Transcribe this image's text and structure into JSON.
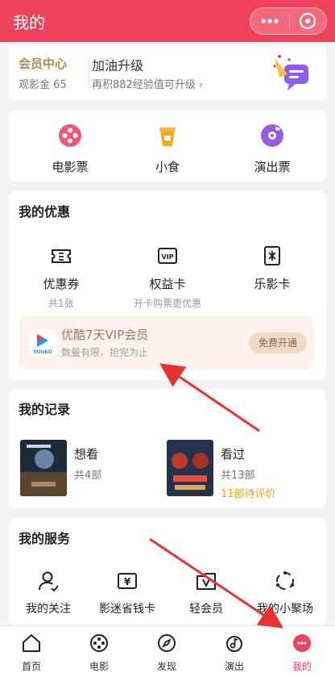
{
  "header": {
    "title": "我的"
  },
  "member": {
    "title": "会员中心",
    "balance": "观影金 65",
    "upgrade_title": "加油升级",
    "upgrade_sub": "再积882经验值可升级 ›"
  },
  "quick": [
    {
      "label": "电影票",
      "icon": "film-reel-icon",
      "color": "#f2557b"
    },
    {
      "label": "小食",
      "icon": "drink-cup-icon",
      "color": "#f5a623"
    },
    {
      "label": "演出票",
      "icon": "music-disc-icon",
      "color": "#9b59e0"
    }
  ],
  "youhui": {
    "title": "我的优惠",
    "items": [
      {
        "label": "优惠券",
        "sub": "共1张",
        "icon": "coupon-icon"
      },
      {
        "label": "权益卡",
        "sub": "开卡购票更优惠",
        "icon": "vip-card-icon"
      },
      {
        "label": "乐影卡",
        "sub": "",
        "icon": "movie-card-icon"
      }
    ],
    "vip": {
      "title": "优酷7天VIP会员",
      "sub": "数量有限，抢完为止",
      "button": "免费开通",
      "logo_text": "YOUKU"
    }
  },
  "record": {
    "title": "我的记录",
    "want": {
      "label": "想看",
      "count": "共4部"
    },
    "seen": {
      "label": "看过",
      "count": "共13部",
      "pending": "11部待评价"
    }
  },
  "service": {
    "title": "我的服务",
    "items": [
      {
        "label": "我的关注",
        "icon": "user-follow-icon"
      },
      {
        "label": "影迷省钱卡",
        "icon": "yen-card-icon"
      },
      {
        "label": "轻会员",
        "icon": "vip-folder-icon"
      },
      {
        "label": "我的小聚场",
        "icon": "circle-dots-icon"
      }
    ]
  },
  "tabs": [
    {
      "label": "首页",
      "icon": "home-icon"
    },
    {
      "label": "电影",
      "icon": "film-icon"
    },
    {
      "label": "发现",
      "icon": "compass-icon"
    },
    {
      "label": "演出",
      "icon": "music-icon"
    },
    {
      "label": "我的",
      "icon": "profile-icon",
      "active": true
    }
  ],
  "colors": {
    "brand": "#f0415b",
    "gold": "#b28a4a",
    "orange": "#f0a21b"
  }
}
